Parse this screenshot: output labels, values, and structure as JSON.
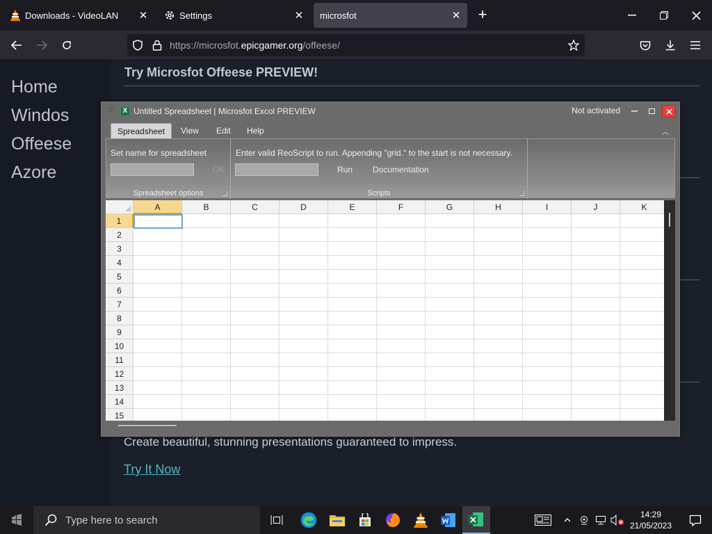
{
  "browser": {
    "tabs": [
      {
        "title": "Downloads - VideoLAN",
        "icon": "vlc-cone-icon",
        "active": false
      },
      {
        "title": "Settings",
        "icon": "gear-icon",
        "active": false
      },
      {
        "title": "microsfot",
        "icon": "",
        "active": true
      }
    ],
    "url_prefix": "https://microsfot.",
    "url_domain": "epicgamer.org",
    "url_path": "/offeese/"
  },
  "site": {
    "nav": [
      "Home",
      "Windos",
      "Offeese",
      "Azore"
    ],
    "heading": "Try Microsfot Offeese PREVIEW!",
    "description": "Create beautiful, stunning presentations guaranteed to impress.",
    "cta": "Try It Now"
  },
  "excol": {
    "title": "Untitled Spreadsheet | Microsfot Excol PREVIEW",
    "activation": "Not activated",
    "menu_tabs": [
      "Spreadsheet",
      "View",
      "Edit",
      "Help"
    ],
    "active_menu_tab": "Spreadsheet",
    "ribbon": {
      "name_label": "Set name for spreadsheet",
      "name_value": "",
      "ok_label": "OK",
      "group1_label": "Spreadsheet options",
      "script_hint": "Enter valid ReoScript to run. Appending \"grid.\" to the start is not necessary.",
      "script_value": "",
      "run_label": "Run",
      "docs_label": "Documentation",
      "group2_label": "Scripts"
    },
    "columns": [
      "A",
      "B",
      "C",
      "D",
      "E",
      "F",
      "G",
      "H",
      "I",
      "J",
      "K"
    ],
    "rows": [
      "1",
      "2",
      "3",
      "4",
      "5",
      "6",
      "7",
      "8",
      "9",
      "10",
      "11",
      "12",
      "13",
      "14",
      "15"
    ],
    "active_cell": "A1"
  },
  "taskbar": {
    "search_placeholder": "Type here to search",
    "time": "14:29",
    "date": "21/05/2023"
  },
  "colors": {
    "accent_link": "#4fb8c4",
    "close_button": "#e04343",
    "selection_header": "#f5d98e"
  }
}
